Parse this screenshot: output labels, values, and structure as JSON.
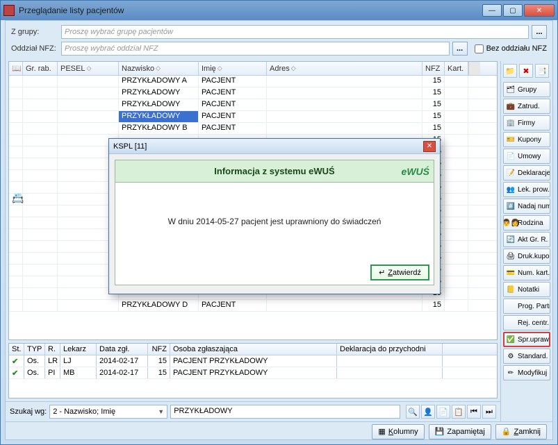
{
  "window": {
    "title": "Przeglądanie listy pacjentów"
  },
  "form": {
    "group_label": "Z grupy:",
    "group_placeholder": "Proszę wybrać grupę pacjentów",
    "nfz_label": "Oddział NFZ:",
    "nfz_placeholder": "Proszę wybrać oddział NFZ",
    "dots": "...",
    "no_nfz_chk": "Bez oddziału NFZ"
  },
  "grid_head": {
    "grrab": "Gr. rab.",
    "pesel": "PESEL",
    "nazwisko": "Nazwisko",
    "imie": "Imię",
    "adres": "Adres",
    "nfz": "NFZ",
    "kart": "Kart."
  },
  "rows": [
    {
      "nazwisko": "PRZYKŁADOWY A",
      "imie": "PACJENT",
      "nfz": "15"
    },
    {
      "nazwisko": "PRZYKŁADOWY",
      "imie": "PACJENT",
      "nfz": "15"
    },
    {
      "nazwisko": "PRZYKŁADOWY",
      "imie": "PACJENT",
      "nfz": "15"
    },
    {
      "nazwisko": "PRZYKŁADOWY",
      "imie": "PACJENT",
      "nfz": "15",
      "sel": true
    },
    {
      "nazwisko": "PRZYKŁADOWY B",
      "imie": "PACJENT",
      "nfz": "15"
    },
    {
      "nazwisko": "",
      "imie": "",
      "nfz": "15"
    },
    {
      "nazwisko": "",
      "imie": "",
      "nfz": "15"
    },
    {
      "nazwisko": "",
      "imie": "",
      "nfz": "15"
    },
    {
      "nazwisko": "",
      "imie": "",
      "nfz": "15"
    },
    {
      "nazwisko": "",
      "imie": "",
      "nfz": "15"
    },
    {
      "nazwisko": "",
      "imie": "",
      "nfz": "15"
    },
    {
      "nazwisko": "",
      "imie": "",
      "nfz": "15"
    },
    {
      "nazwisko": "",
      "imie": "",
      "nfz": "15"
    },
    {
      "nazwisko": "",
      "imie": "",
      "nfz": "15"
    },
    {
      "nazwisko": "",
      "imie": "",
      "nfz": "15"
    },
    {
      "nazwisko": "",
      "imie": "",
      "nfz": "15"
    },
    {
      "nazwisko": "",
      "imie": "",
      "nfz": "15"
    },
    {
      "nazwisko": "",
      "imie": "",
      "nfz": "15"
    },
    {
      "nazwisko": "",
      "imie": "",
      "nfz": "15"
    },
    {
      "nazwisko": "PRZYKŁADOWY D",
      "imie": "PACJENT",
      "nfz": "15"
    }
  ],
  "grid2_head": {
    "st": "St.",
    "typ": "TYP",
    "r": "R.",
    "lekarz": "Lekarz",
    "data": "Data zgł.",
    "nfz": "NFZ",
    "osoba": "Osoba zgłaszająca",
    "dekl": "Deklaracja do przychodni"
  },
  "rows2": [
    {
      "st": "✔",
      "typ": "Os.",
      "r": "LR",
      "lekarz": "LJ",
      "data": "2014-02-17",
      "nfz": "15",
      "osoba": "PACJENT PRZYKŁADOWY",
      "dekl": ""
    },
    {
      "st": "✔",
      "typ": "Os.",
      "r": "PI",
      "lekarz": "MB",
      "data": "2014-02-17",
      "nfz": "15",
      "osoba": "PACJENT PRZYKŁADOWY",
      "dekl": ""
    }
  ],
  "search": {
    "label": "Szukaj wg:",
    "mode": "2 - Nazwisko; Imię",
    "value": "PRZYKŁADOWY"
  },
  "bottom": {
    "kolumny": "Kolumny",
    "zapamietaj": "Zapamiętaj",
    "zamknij": "Zamknij"
  },
  "side": {
    "grupy": "Grupy",
    "zatrud": "Zatrud.",
    "firmy": "Firmy",
    "kupony": "Kupony",
    "umowy": "Umowy",
    "deklaracje": "Deklaracje",
    "lekprow": "Lek. prow.",
    "nadajnum": "Nadaj num.",
    "rodzina": "Rodzina",
    "aktgrr": "Akt Gr. R.",
    "drukkupon": "Druk.kupon",
    "numkart": "Num. kart.",
    "notatki": "Notatki",
    "progpartn": "Prog. Partn.",
    "rejcentr": "Rej. centr.",
    "sprupraw": "Spr.upraw.",
    "standard": "Standard.",
    "modyfikuj": "Modyfikuj"
  },
  "modal": {
    "title": "KSPL [11]",
    "header": "Informacja z systemu eWUŚ",
    "logo": "eWUŚ",
    "msg": "W dniu 2014-05-27 pacjent jest uprawniony do świadczeń",
    "confirm": "Zatwierdź"
  }
}
